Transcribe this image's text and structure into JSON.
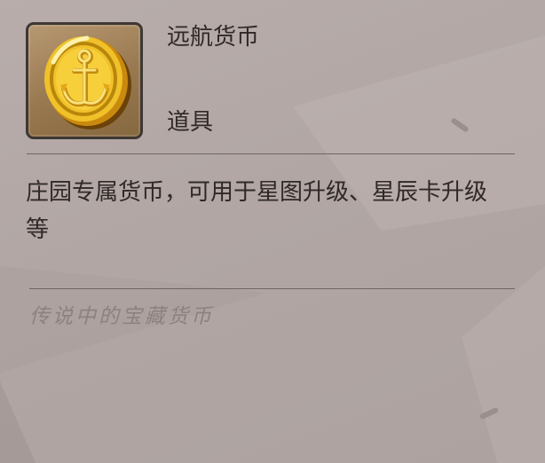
{
  "item": {
    "name": "远航货币",
    "type": "道具",
    "description": "庄园专属货币，可用于星图升级、星辰卡升级等",
    "flavor_text": "传说中的宝藏货币",
    "icon": "anchor-coin-icon"
  },
  "colors": {
    "panel_background": "#b3a8a6",
    "text": "#2f2927",
    "flavor_text": "#8b8180",
    "coin_gold": "#e8b21c",
    "icon_frame_border": "#3e3734"
  }
}
